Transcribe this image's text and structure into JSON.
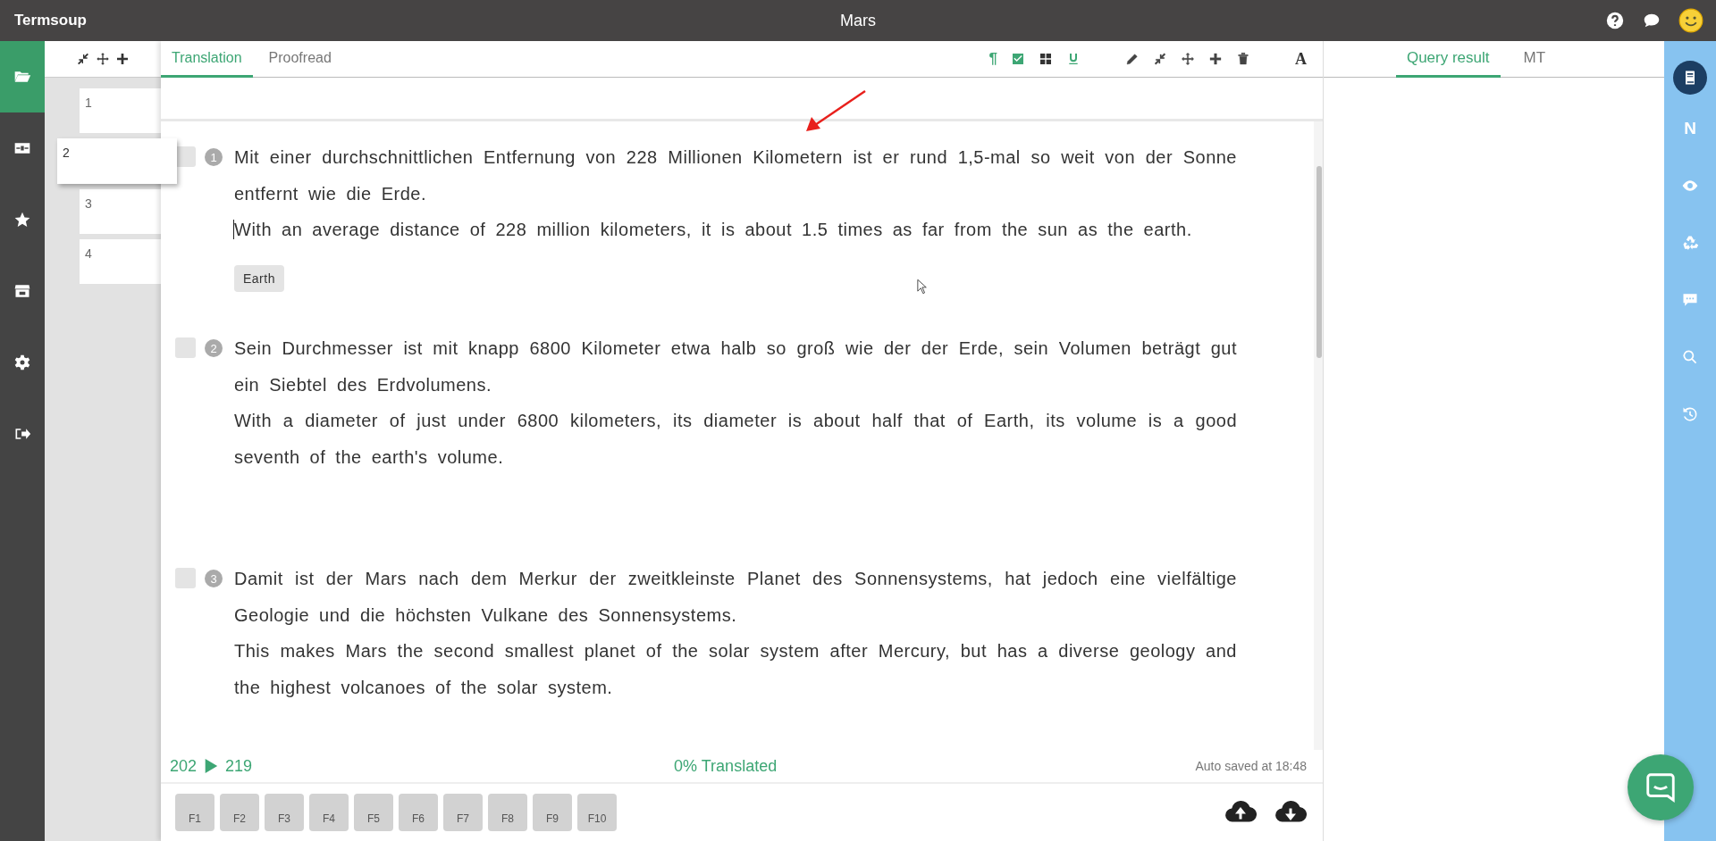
{
  "app_title": "Termsoup",
  "document_title": "Mars",
  "left_nav": [
    {
      "kind": "folder",
      "selected": true
    },
    {
      "kind": "panel",
      "selected": false
    },
    {
      "kind": "star",
      "selected": false
    },
    {
      "kind": "store",
      "selected": false
    },
    {
      "kind": "gear",
      "selected": false
    },
    {
      "kind": "signout",
      "selected": false
    }
  ],
  "pages": {
    "items": [
      {
        "label": "1",
        "selected": false
      },
      {
        "label": "2",
        "selected": true
      },
      {
        "label": "3",
        "selected": false
      },
      {
        "label": "4",
        "selected": false
      }
    ]
  },
  "editor": {
    "tabs": [
      {
        "label": "Translation",
        "selected": true
      },
      {
        "label": "Proofread",
        "selected": false
      }
    ],
    "toggles": [
      {
        "kind": "pilcrow",
        "label": "¶",
        "on": true
      },
      {
        "kind": "checksquare",
        "on": true
      },
      {
        "kind": "grid",
        "on": false
      },
      {
        "kind": "underline",
        "on": true
      }
    ],
    "font_button": "A",
    "segments": [
      {
        "number": "1",
        "checked": false,
        "source": "Mit einer durchschnittlichen Entfernung von 228 Millionen Kilometern ist er rund 1,5-mal so weit von der Sonne entfernt wie die Erde.",
        "target": "With an average distance of 228 million kilometers, it is about 1.5 times as far from the sun as the earth.",
        "tags": [
          "Earth"
        ]
      },
      {
        "number": "2",
        "checked": false,
        "source": "Sein Durchmesser ist mit knapp 6800 Kilometer etwa halb so groß wie der der Erde, sein Volumen beträgt gut ein Siebtel des Erdvolumens.",
        "target": "With a diameter of just under 6800 kilometers, its diameter is about half that of Earth, its volume is a good seventh of the earth's volume."
      },
      {
        "number": "3",
        "checked": false,
        "source": "Damit ist der Mars nach dem Merkur der zweitkleinste Planet des Sonnensystems, hat jedoch eine vielfältige Geologie und die höchsten Vulkane des Sonnensystems.",
        "target": "This makes Mars the second smallest planet of the solar system after Mercury, but has a diverse geology and the highest volcanoes of the solar system."
      }
    ],
    "progress": {
      "current": "202",
      "total": "219",
      "status": "0% Translated",
      "saved": "Auto saved at 18:48"
    },
    "function_keys": [
      "F1",
      "F2",
      "F3",
      "F4",
      "F5",
      "F6",
      "F7",
      "F8",
      "F9",
      "F10"
    ]
  },
  "side_panel": {
    "tabs": [
      {
        "label": "Query result",
        "selected": true
      },
      {
        "label": "MT",
        "selected": false
      }
    ]
  },
  "right_nav": [
    {
      "kind": "book",
      "selected": true
    },
    {
      "kind": "letter",
      "label": "N",
      "selected": false
    },
    {
      "kind": "eye",
      "selected": false
    },
    {
      "kind": "recycle",
      "selected": false
    },
    {
      "kind": "comment",
      "selected": false
    },
    {
      "kind": "search",
      "selected": false
    },
    {
      "kind": "history",
      "selected": false
    }
  ]
}
